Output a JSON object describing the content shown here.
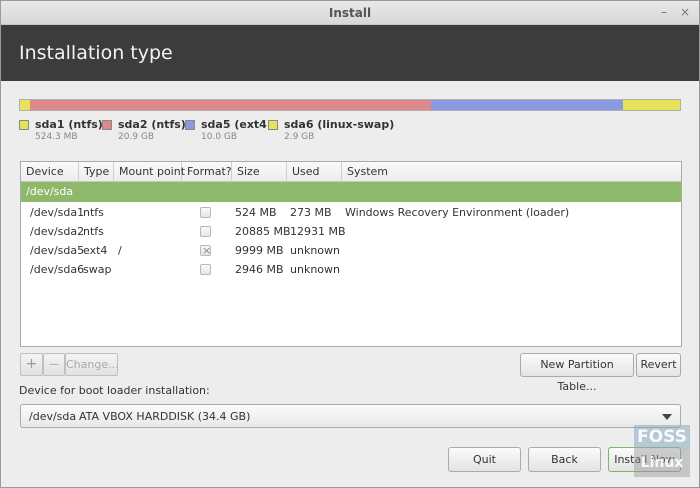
{
  "window": {
    "title": "Install"
  },
  "header": {
    "title": "Installation type"
  },
  "partition_bar": {
    "segments": [
      {
        "name": "sda1",
        "color": "#e5e35a",
        "size_mb": 524
      },
      {
        "name": "sda2",
        "color": "#dc8a8a",
        "size_mb": 20885
      },
      {
        "name": "sda5",
        "color": "#8a9ae0",
        "size_mb": 9999
      },
      {
        "name": "sda6",
        "color": "#e5e35a",
        "size_mb": 2946
      }
    ]
  },
  "legend": [
    {
      "name": "sda1 (ntfs)",
      "size": "524.3 MB",
      "color": "#e5e35a"
    },
    {
      "name": "sda2 (ntfs)",
      "size": "20.9 GB",
      "color": "#dc8a8a"
    },
    {
      "name": "sda5 (ext4)",
      "size": "10.0 GB",
      "color": "#8a9ae0"
    },
    {
      "name": "sda6 (linux-swap)",
      "size": "2.9 GB",
      "color": "#e5e35a"
    }
  ],
  "table": {
    "columns": [
      "Device",
      "Type",
      "Mount point",
      "Format?",
      "Size",
      "Used",
      "System"
    ],
    "device": "/dev/sda",
    "rows": [
      {
        "device": "/dev/sda1",
        "type": "ntfs",
        "mount": "",
        "format": false,
        "size": "524 MB",
        "used": "273 MB",
        "system": "Windows Recovery Environment (loader)"
      },
      {
        "device": "/dev/sda2",
        "type": "ntfs",
        "mount": "",
        "format": false,
        "size": "20885 MB",
        "used": "12931 MB",
        "system": ""
      },
      {
        "device": "/dev/sda5",
        "type": "ext4",
        "mount": "/",
        "format": true,
        "size": "9999 MB",
        "used": "unknown",
        "system": ""
      },
      {
        "device": "/dev/sda6",
        "type": "swap",
        "mount": "",
        "format": false,
        "size": "2946 MB",
        "used": "unknown",
        "system": ""
      }
    ]
  },
  "toolbar": {
    "add": "+",
    "remove": "—",
    "change": "Change...",
    "new_partition_table": "New Partition Table...",
    "revert": "Revert"
  },
  "bootloader": {
    "label": "Device for boot loader installation:",
    "device": "/dev/sda",
    "disk": "ATA VBOX HARDDISK (34.4 GB)"
  },
  "buttons": {
    "quit": "Quit",
    "back": "Back",
    "install": "Install Now"
  },
  "watermark": {
    "top": "FOSS",
    "bottom": "Linux"
  }
}
